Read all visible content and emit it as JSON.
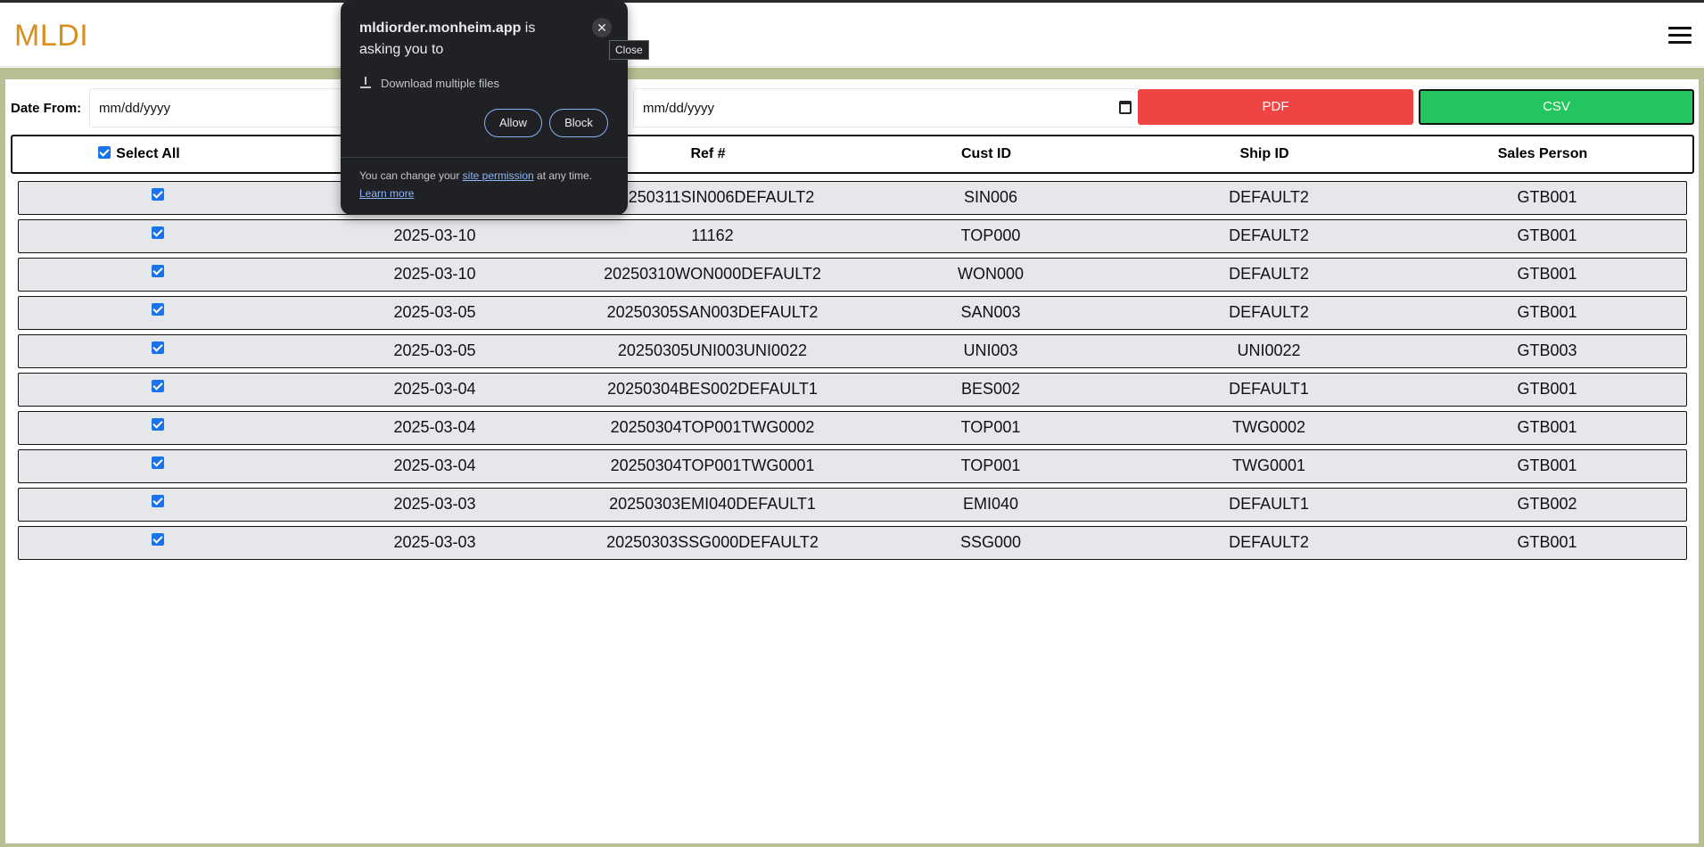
{
  "header": {
    "logo": "MLDI",
    "menu_icon": "hamburger-menu-icon"
  },
  "filters": {
    "date_from_label": "Date From:",
    "date_from_value": "mm/dd/yyyy",
    "date_to_value": "mm/dd/yyyy",
    "pdf_label": "PDF",
    "csv_label": "CSV",
    "pdf_color": "#ef4444",
    "csv_color": "#22c55e"
  },
  "table": {
    "select_all_label": "Select All",
    "columns": [
      "",
      "",
      "Ref #",
      "Cust ID",
      "Ship ID",
      "Sales Person"
    ],
    "rows": [
      {
        "date": "",
        "ref": "20250311SIN006DEFAULT2",
        "cust": "SIN006",
        "ship": "DEFAULT2",
        "sales": "GTB001"
      },
      {
        "date": "2025-03-10",
        "ref": "11162",
        "cust": "TOP000",
        "ship": "DEFAULT2",
        "sales": "GTB001"
      },
      {
        "date": "2025-03-10",
        "ref": "20250310WON000DEFAULT2",
        "cust": "WON000",
        "ship": "DEFAULT2",
        "sales": "GTB001"
      },
      {
        "date": "2025-03-05",
        "ref": "20250305SAN003DEFAULT2",
        "cust": "SAN003",
        "ship": "DEFAULT2",
        "sales": "GTB001"
      },
      {
        "date": "2025-03-05",
        "ref": "20250305UNI003UNI0022",
        "cust": "UNI003",
        "ship": "UNI0022",
        "sales": "GTB003"
      },
      {
        "date": "2025-03-04",
        "ref": "20250304BES002DEFAULT1",
        "cust": "BES002",
        "ship": "DEFAULT1",
        "sales": "GTB001"
      },
      {
        "date": "2025-03-04",
        "ref": "20250304TOP001TWG0002",
        "cust": "TOP001",
        "ship": "TWG0002",
        "sales": "GTB001"
      },
      {
        "date": "2025-03-04",
        "ref": "20250304TOP001TWG0001",
        "cust": "TOP001",
        "ship": "TWG0001",
        "sales": "GTB001"
      },
      {
        "date": "2025-03-03",
        "ref": "20250303EMI040DEFAULT1",
        "cust": "EMI040",
        "ship": "DEFAULT1",
        "sales": "GTB002"
      },
      {
        "date": "2025-03-03",
        "ref": "20250303SSG000DEFAULT2",
        "cust": "SSG000",
        "ship": "DEFAULT2",
        "sales": "GTB001"
      }
    ]
  },
  "popup": {
    "site": "mldiorder.monheim.app",
    "title_suffix": " is asking you to",
    "request": "Download multiple files",
    "allow_label": "Allow",
    "block_label": "Block",
    "foot_prefix": "You can change your ",
    "foot_link": "site permission",
    "foot_suffix": " at any time.",
    "learn_more": "Learn more",
    "close_tooltip": "Close"
  }
}
